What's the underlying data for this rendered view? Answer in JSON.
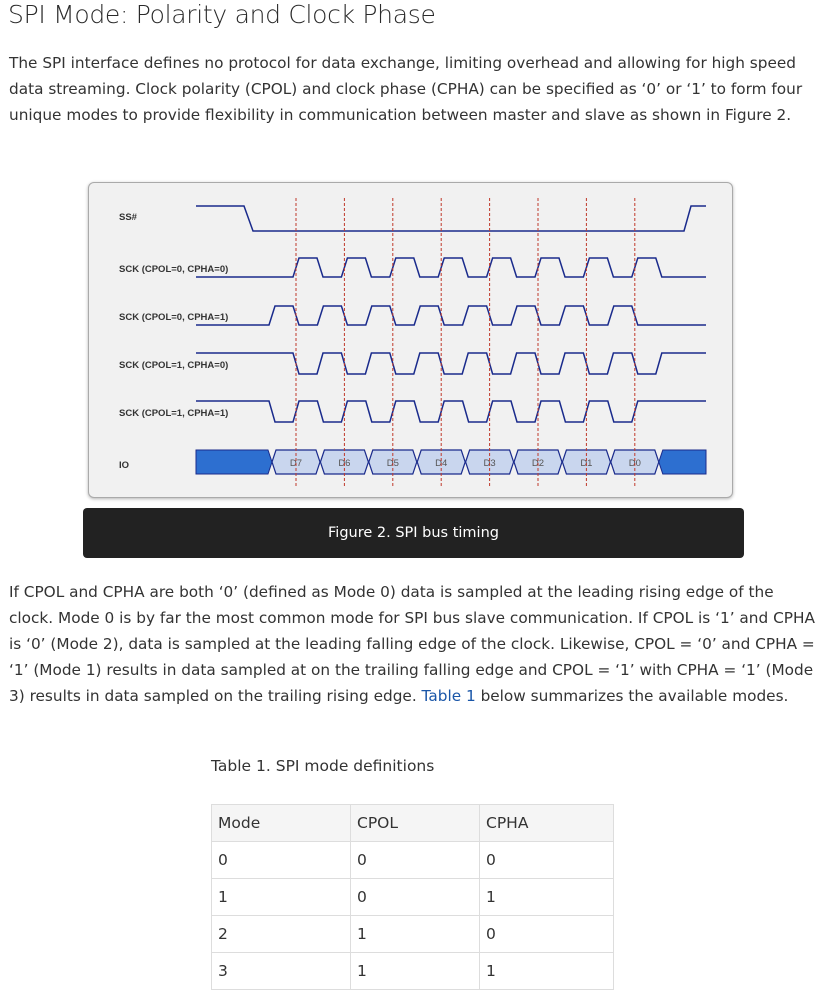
{
  "title": "SPI Mode: Polarity and Clock Phase",
  "intro": "The SPI interface defines no protocol for data exchange, limiting overhead and allowing for high speed data streaming. Clock polarity (CPOL) and clock phase (CPHA) can be specified as  ‘0’  or  ‘1’  to form four unique modes to provide flexibility in communication between master and slave as shown in Figure 2.",
  "figure": {
    "signals": [
      "SS#",
      "SCK (CPOL=0, CPHA=0)",
      "SCK (CPOL=0, CPHA=1)",
      "SCK (CPOL=1, CPHA=0)",
      "SCK (CPOL=1, CPHA=1)",
      "IO"
    ],
    "bits": [
      "D7",
      "D6",
      "D5",
      "D4",
      "D3",
      "D2",
      "D1",
      "D0"
    ],
    "colors": {
      "signal": "#1a2b8c",
      "sample_line": "#c0392b",
      "bus_fill": "#2d6fd0",
      "bit_fill": "#c9d6ee"
    },
    "caption": "Figure 2. SPI bus timing"
  },
  "body": {
    "before_link": "If CPOL and CPHA are both  ‘0’  (defined as Mode 0) data is sampled at the leading rising edge of the clock. Mode 0 is by far the most common mode for SPI bus slave communication. If CPOL is  ‘1’  and CPHA is  ‘0’  (Mode 2), data is sampled at the leading falling edge of the clock. Likewise, CPOL =  ‘0’  and CPHA =  ‘1’  (Mode 1) results in data sampled at on the trailing falling edge and CPOL =  ‘1’  with CPHA =  ‘1’  (Mode 3) results in data sampled on the trailing rising edge. ",
    "link": "Table 1",
    "after_link": " below summarizes the available modes."
  },
  "table": {
    "caption": "Table 1. SPI mode definitions",
    "headers": [
      "Mode",
      "CPOL",
      "CPHA"
    ],
    "rows": [
      [
        "0",
        "0",
        "0"
      ],
      [
        "1",
        "0",
        "1"
      ],
      [
        "2",
        "1",
        "0"
      ],
      [
        "3",
        "1",
        "1"
      ]
    ]
  }
}
